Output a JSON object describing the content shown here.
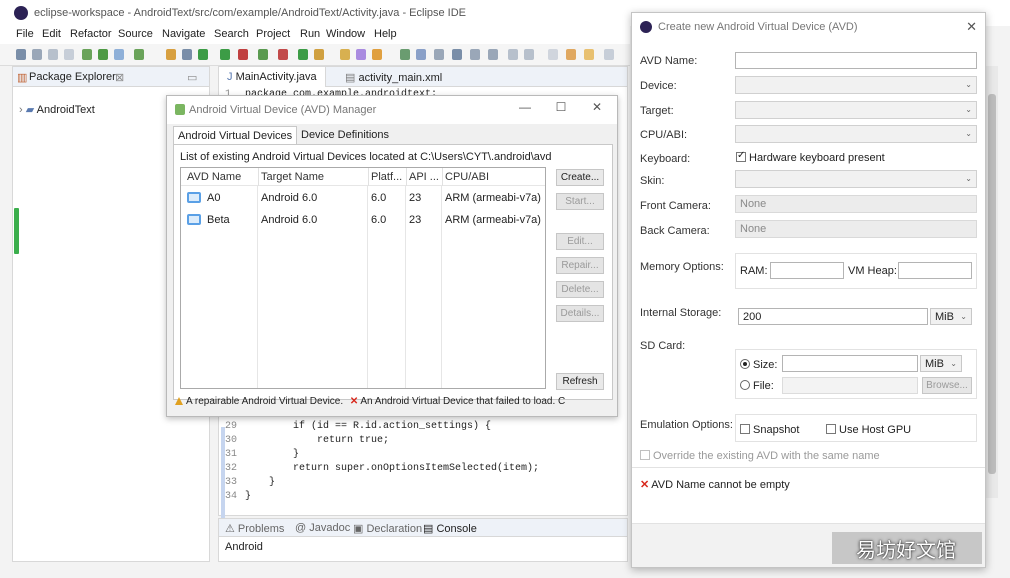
{
  "eclipse": {
    "title": "eclipse-workspace - AndroidText/src/com/example/AndroidText/Activity.java - Eclipse IDE",
    "menu": [
      "File",
      "Edit",
      "Refactor",
      "Source",
      "Navigate",
      "Search",
      "Project",
      "Run",
      "Window",
      "Help"
    ],
    "package_explorer": {
      "tab_label": "Package Explorer",
      "tab_suffix": "⊠",
      "project": "AndroidText"
    },
    "editor": {
      "tabs": [
        "MainActivity.java",
        "activity_main.xml"
      ],
      "first_line": "package com.example.androidtext;",
      "code": [
        {
          "num": "29",
          "text": "        if (id == R.id.action_settings) {"
        },
        {
          "num": "30",
          "text": "            return true;"
        },
        {
          "num": "31",
          "text": "        }"
        },
        {
          "num": "32",
          "text": "        return super.onOptionsItemSelected(item);"
        },
        {
          "num": "33",
          "text": "    }"
        },
        {
          "num": "34",
          "text": "}"
        }
      ]
    },
    "bottom_tabs": [
      "Problems",
      "Javadoc",
      "Declaration",
      "Console"
    ],
    "console_text": "Android"
  },
  "avd_manager": {
    "title": "Android Virtual Device (AVD) Manager",
    "tabs": [
      "Android Virtual Devices",
      "Device Definitions"
    ],
    "list_label": "List of existing Android Virtual Devices located at C:\\Users\\CYT\\.android\\avd",
    "columns": [
      "AVD Name",
      "Target Name",
      "Platf...",
      "API ...",
      "CPU/ABI"
    ],
    "rows": [
      {
        "name": "A0",
        "target": "Android 6.0",
        "platform": "6.0",
        "api": "23",
        "cpu": "ARM (armeabi-v7a)"
      },
      {
        "name": "Beta",
        "target": "Android 6.0",
        "platform": "6.0",
        "api": "23",
        "cpu": "ARM (armeabi-v7a)"
      }
    ],
    "buttons": {
      "create": "Create...",
      "start": "Start...",
      "edit": "Edit...",
      "repair": "Repair...",
      "delete": "Delete...",
      "details": "Details...",
      "refresh": "Refresh"
    },
    "status_warning": "A repairable Android Virtual Device.",
    "status_error": "An Android Virtual Device that failed to load. C"
  },
  "create_avd": {
    "title": "Create new Android Virtual Device (AVD)",
    "labels": {
      "avd_name": "AVD Name:",
      "device": "Device:",
      "target": "Target:",
      "cpu_abi": "CPU/ABI:",
      "keyboard": "Keyboard:",
      "skin": "Skin:",
      "front_camera": "Front Camera:",
      "back_camera": "Back Camera:",
      "memory_options": "Memory Options:",
      "ram": "RAM:",
      "vm_heap": "VM Heap:",
      "internal_storage": "Internal Storage:",
      "sd_card": "SD Card:",
      "size": "Size:",
      "file": "File:",
      "emulation_options": "Emulation Options:"
    },
    "keyboard_checkbox": "Hardware keyboard present",
    "front_camera_value": "None",
    "back_camera_value": "None",
    "internal_storage_value": "200",
    "internal_storage_unit": "MiB",
    "sd_size_unit": "MiB",
    "browse_button": "Browse...",
    "snapshot_label": "Snapshot",
    "host_gpu_label": "Use Host GPU",
    "override_label": "Override the existing AVD with the same name",
    "error_message": "AVD Name cannot be empty"
  },
  "watermark": "易坊好文馆"
}
